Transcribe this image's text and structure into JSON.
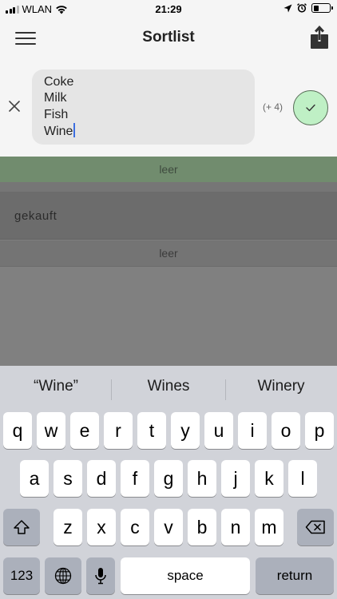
{
  "status_bar": {
    "carrier": "WLAN",
    "time": "21:29"
  },
  "header": {
    "title": "Sortlist"
  },
  "input": {
    "lines": [
      "Coke",
      "Milk",
      "Fish",
      "Wine"
    ],
    "count_label": "(+ 4)"
  },
  "list": {
    "active_empty_label": "leer",
    "done_section_label": "gekauft",
    "done_empty_label": "leer"
  },
  "keyboard": {
    "suggestions": [
      "“Wine”",
      "Wines",
      "Winery"
    ],
    "row1": [
      "q",
      "w",
      "e",
      "r",
      "t",
      "y",
      "u",
      "i",
      "o",
      "p"
    ],
    "row2": [
      "a",
      "s",
      "d",
      "f",
      "g",
      "h",
      "j",
      "k",
      "l"
    ],
    "row3": [
      "z",
      "x",
      "c",
      "v",
      "b",
      "n",
      "m"
    ],
    "numbers_key": "123",
    "space_key": "space",
    "return_key": "return"
  },
  "colors": {
    "confirm_button": "#bff0c5",
    "active_empty_row": "#718c6e",
    "caret": "#3d6fe0"
  },
  "icons": [
    "signal-icon",
    "wifi-icon",
    "location-icon",
    "alarm-icon",
    "battery-icon",
    "menu-icon",
    "share-icon",
    "close-icon",
    "checkmark-icon",
    "shift-icon",
    "globe-icon",
    "microphone-icon",
    "backspace-icon"
  ]
}
